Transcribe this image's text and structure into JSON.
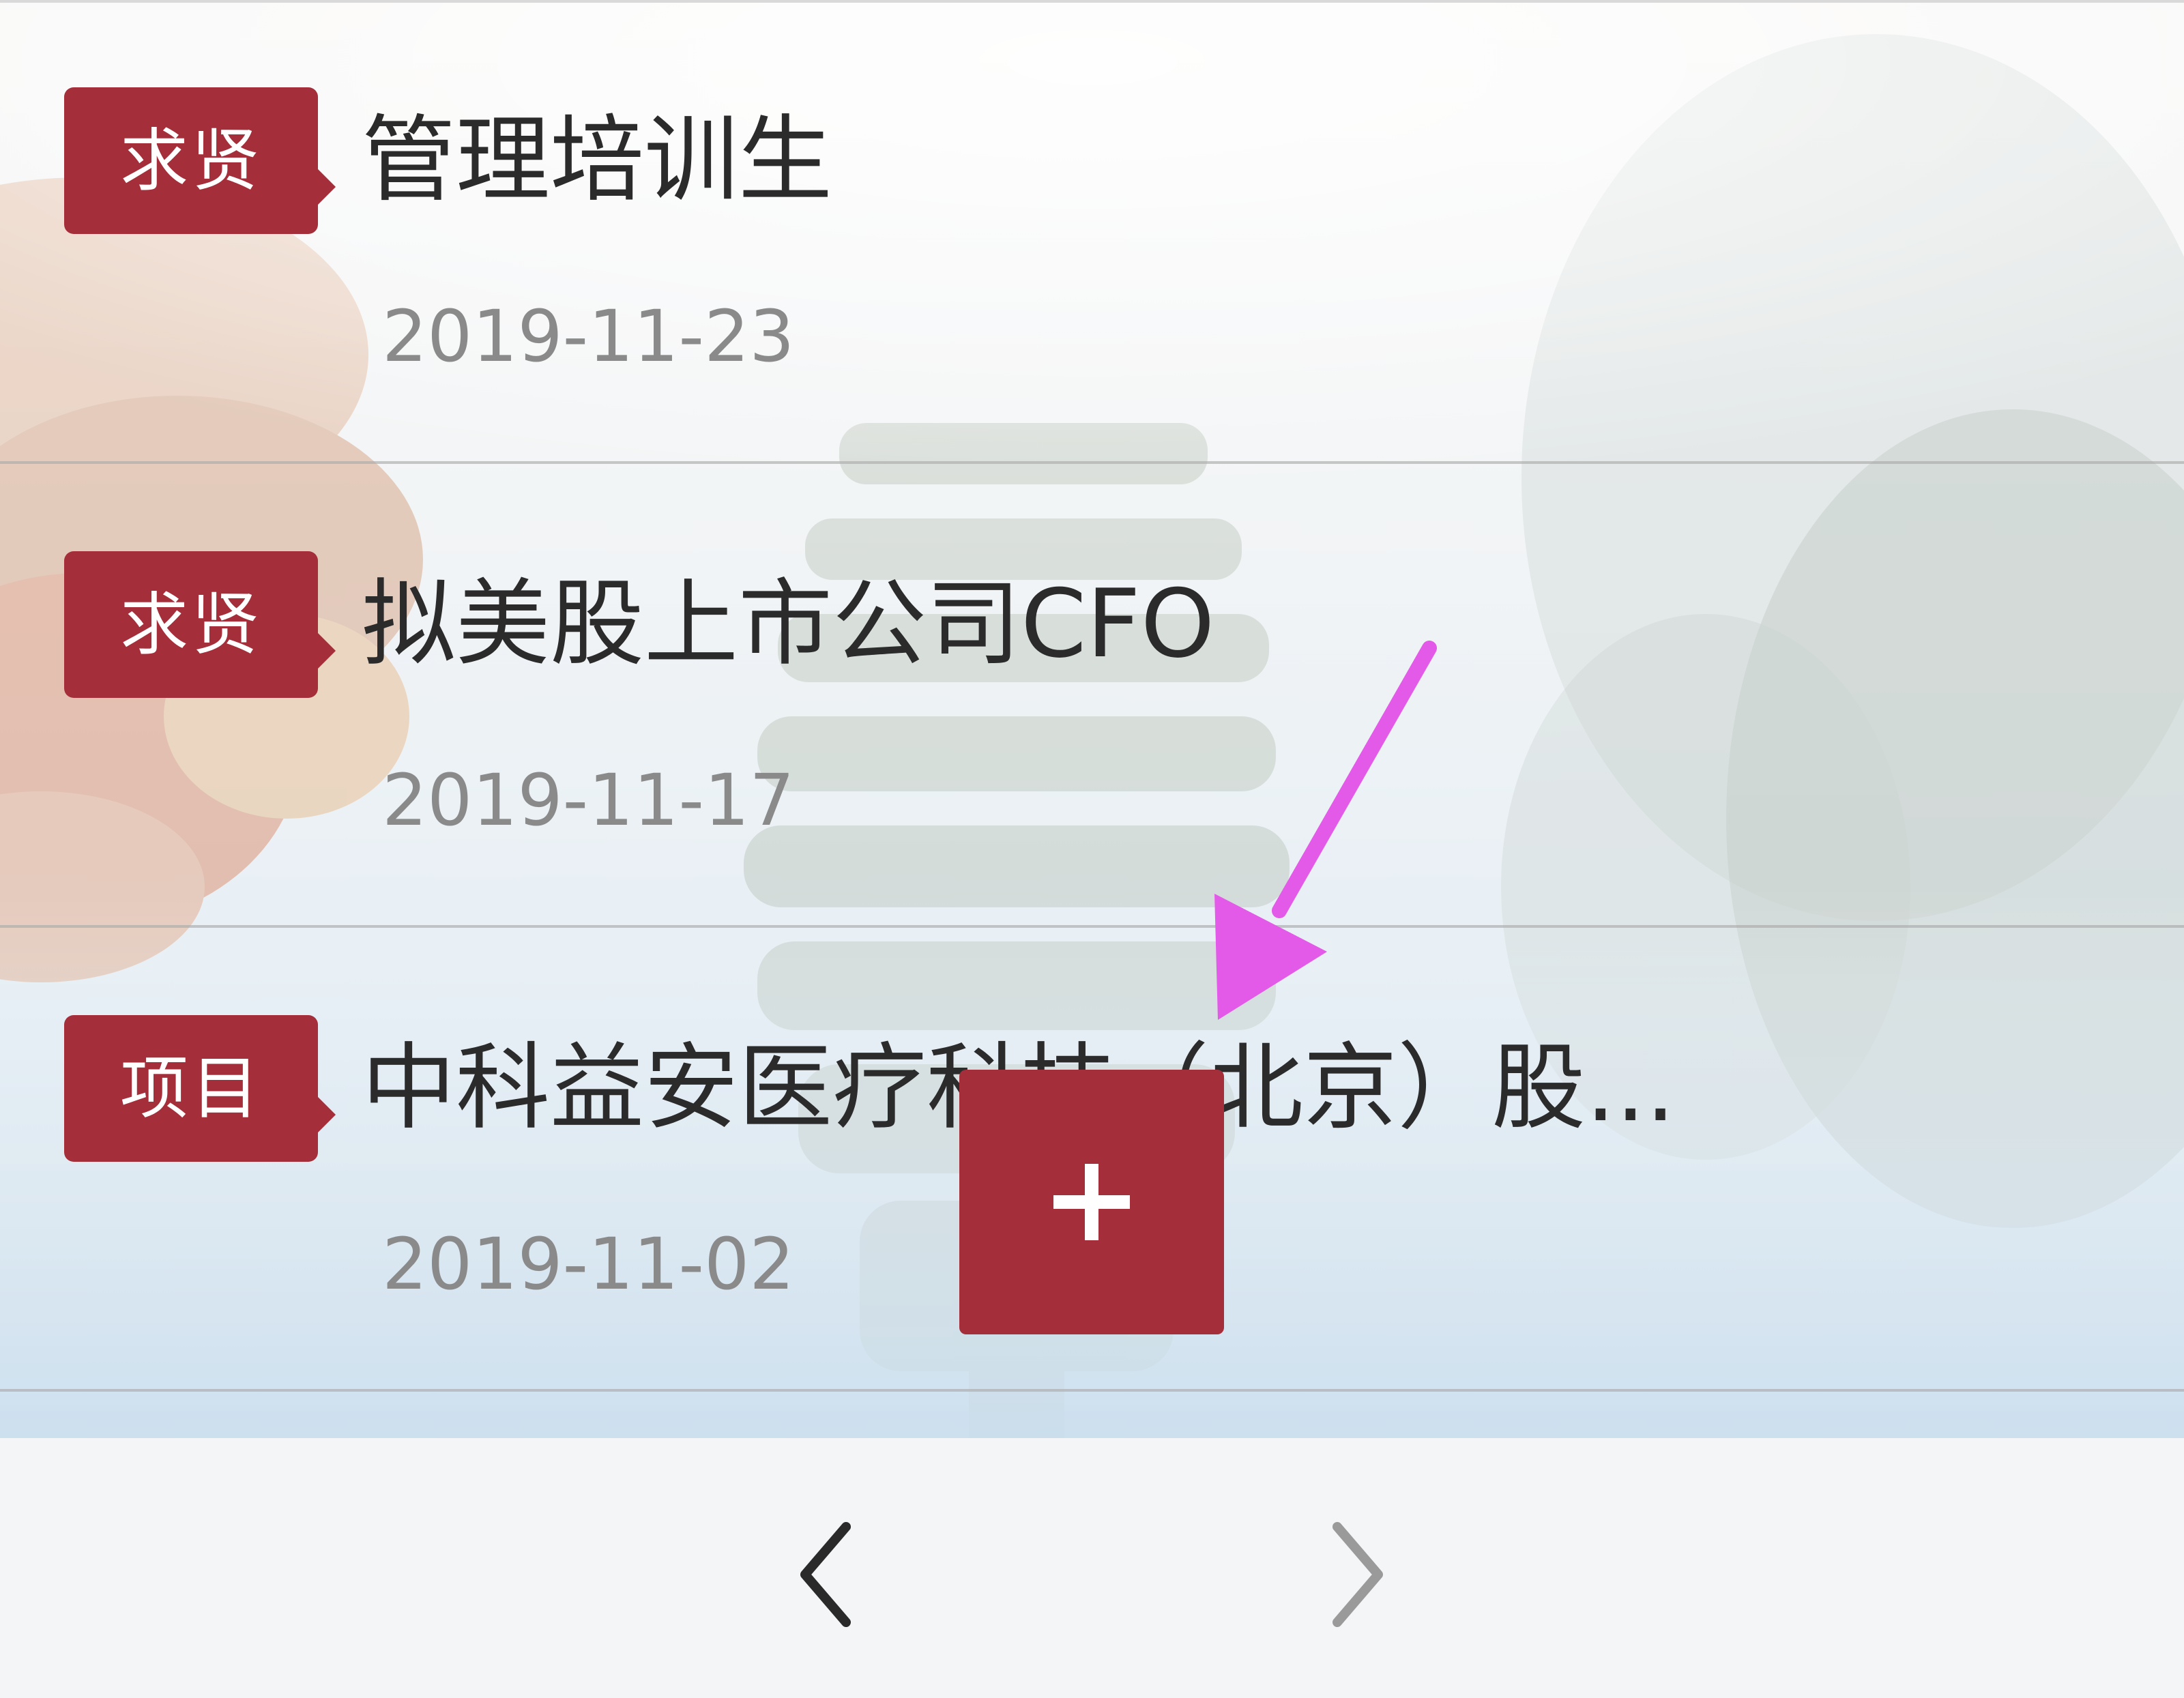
{
  "list": {
    "items": [
      {
        "tag": "求贤",
        "title": "管理培训生",
        "date": "2019-11-23"
      },
      {
        "tag": "求贤",
        "title": "拟美股上市公司CFO",
        "date": "2019-11-17"
      },
      {
        "tag": "项目",
        "title": "中科益安医疗科技（北京）股...",
        "date": "2019-11-02"
      }
    ]
  },
  "colors": {
    "accent": "#a42e3a",
    "annotation_arrow": "#e35ae8",
    "date_text": "#8a8a8a"
  },
  "fab": {
    "icon": "plus-icon"
  },
  "bottom_nav": {
    "back_icon": "chevron-left-icon",
    "forward_icon": "chevron-right-icon"
  }
}
